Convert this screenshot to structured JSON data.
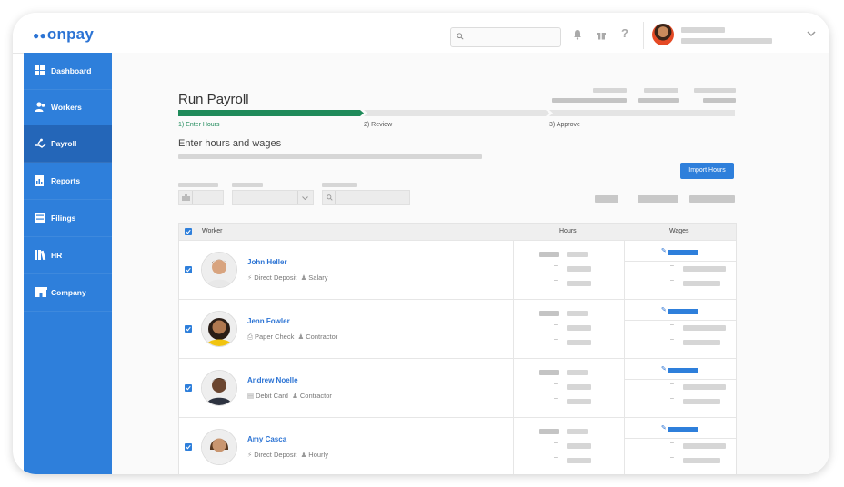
{
  "app": {
    "brand": "onpay",
    "brand_color": "#2b73d4",
    "accent_green": "#1f8a5a"
  },
  "topbar": {
    "search_placeholder": "",
    "icons": [
      "search-icon",
      "bell-icon",
      "gift-icon",
      "help-icon",
      "chevron-down-icon"
    ]
  },
  "sidebar": {
    "items": [
      {
        "label": "Dashboard",
        "icon": "dashboard-icon"
      },
      {
        "label": "Workers",
        "icon": "workers-icon"
      },
      {
        "label": "Payroll",
        "icon": "payroll-icon",
        "active": true
      },
      {
        "label": "Reports",
        "icon": "reports-icon"
      },
      {
        "label": "Filings",
        "icon": "filings-icon"
      },
      {
        "label": "HR",
        "icon": "hr-icon"
      },
      {
        "label": "Company",
        "icon": "company-icon"
      }
    ]
  },
  "page": {
    "title": "Run Payroll",
    "steps": [
      {
        "label": "1) Enter Hours",
        "active": true
      },
      {
        "label": "2) Review",
        "active": false
      },
      {
        "label": "3) Approve",
        "active": false
      }
    ],
    "section_title": "Enter hours and wages",
    "import_button": "Import Hours"
  },
  "table": {
    "headers": {
      "worker": "Worker",
      "hours": "Hours",
      "wages": "Wages"
    },
    "rows": [
      {
        "name": "John Heller",
        "payment": "Direct Deposit",
        "payment_icon": "lightning-icon",
        "type": "Salary"
      },
      {
        "name": "Jenn Fowler",
        "payment": "Paper Check",
        "payment_icon": "printer-icon",
        "type": "Contractor"
      },
      {
        "name": "Andrew Noelle",
        "payment": "Debit Card",
        "payment_icon": "card-icon",
        "type": "Contractor"
      },
      {
        "name": "Amy Casca",
        "payment": "Direct Deposit",
        "payment_icon": "lightning-icon",
        "type": "Hourly"
      }
    ]
  }
}
